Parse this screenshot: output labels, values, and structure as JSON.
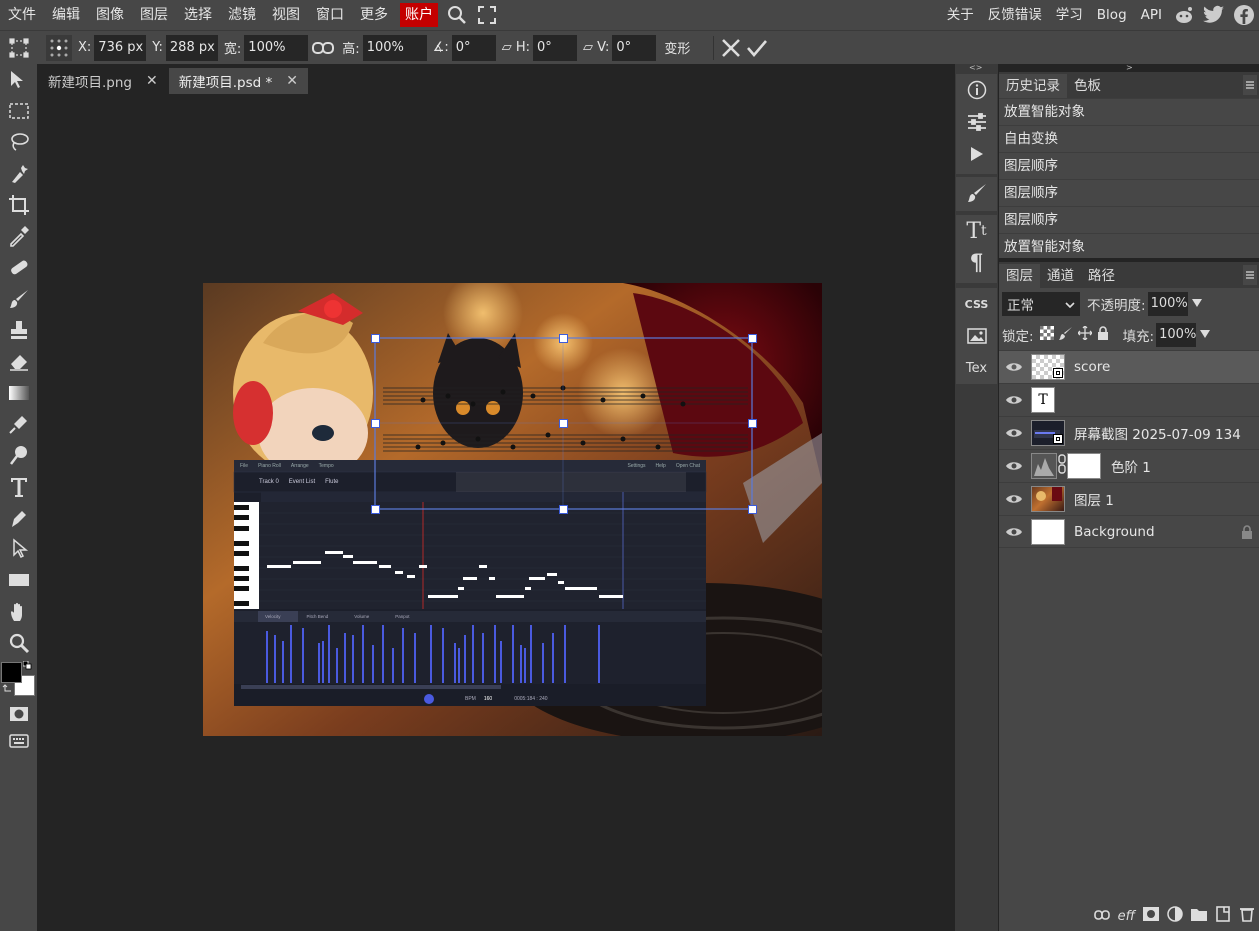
{
  "menu": {
    "items": [
      "文件",
      "编辑",
      "图像",
      "图层",
      "选择",
      "滤镜",
      "视图",
      "窗口",
      "更多"
    ],
    "account": "账户",
    "right": [
      "关于",
      "反馈错误",
      "学习",
      "Blog",
      "API"
    ]
  },
  "options": {
    "x_label": "X:",
    "x_value": "736 px",
    "y_label": "Y:",
    "y_value": "288 px",
    "w_label": "宽:",
    "w_value": "100%",
    "h_label": "高:",
    "h_value": "100%",
    "angle_label": "∡:",
    "angle_value": "0°",
    "skewh_label": "H:",
    "skewh_value": "0°",
    "skewv_label": "V:",
    "skewv_value": "0°",
    "transform_label": "变形"
  },
  "doc_tabs": [
    {
      "label": "新建项目.png",
      "close": "✕"
    },
    {
      "label": "新建项目.psd *",
      "close": "✕"
    }
  ],
  "side_strip": {
    "css": "CSS",
    "tex": "Tex",
    "collapse_left": "<>",
    "collapse_right": "><"
  },
  "history": {
    "tabs": [
      "历史记录",
      "色板"
    ],
    "rows": [
      "放置智能对象",
      "自由变换",
      "图层顺序",
      "图层顺序",
      "图层顺序",
      "放置智能对象"
    ]
  },
  "layers": {
    "tabs": [
      "图层",
      "通道",
      "路径"
    ],
    "blend": "正常",
    "opacity_label": "不透明度:",
    "opacity_value": "100%",
    "lock_label": "锁定:",
    "fill_label": "填充:",
    "fill_value": "100%",
    "rows": [
      "score",
      "",
      "屏幕截图 2025-07-09 134",
      "色阶 1",
      "图层 1",
      "Background"
    ],
    "text_thumb": "T",
    "footer_eff": "eff"
  },
  "embedded": {
    "menu": [
      "File",
      "Piano Roll",
      "Arrange",
      "Tempo",
      "Settings",
      "Help",
      "Open Chat"
    ],
    "track": "Track 0",
    "event_list": "Event List",
    "instrument": "Flute",
    "bottom_tabs": [
      "Velocity",
      "Pitch Bend",
      "Volume",
      "Panpot"
    ],
    "bpm_label": "BPM",
    "bpm_value": "160",
    "time": "0005:184 : 240"
  }
}
